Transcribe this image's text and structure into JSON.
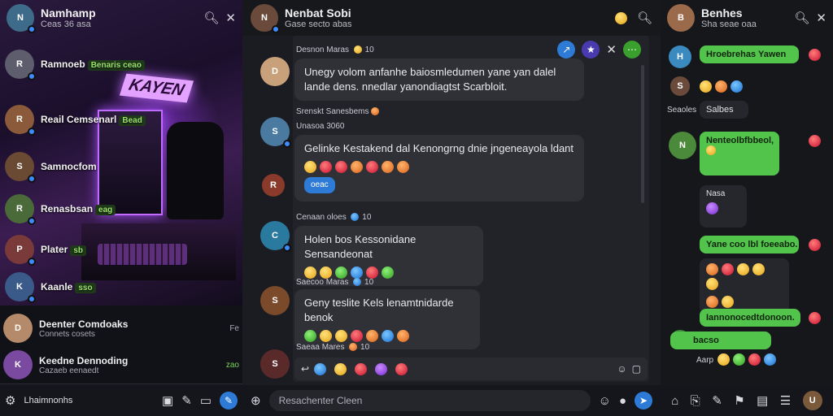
{
  "left": {
    "header": {
      "title": "Namhamp",
      "subtitle": "Ceas 36 asa"
    },
    "hero_sign": "KAYEN",
    "chats": [
      {
        "name": "Ramnoeb",
        "tag": "Benaris ceao"
      },
      {
        "name": "Reail Cemsenarl",
        "tag": "Bead"
      },
      {
        "name": "Samnocfom",
        "tag": ""
      },
      {
        "name": "Renasbsan",
        "tag": "eag"
      },
      {
        "name": "Plater",
        "tag": "sb"
      },
      {
        "name": "Kaanle",
        "tag": "sso"
      }
    ],
    "list": [
      {
        "name": "Deenter Comdoaks",
        "sub": "Connets cosets",
        "meta": "Fe"
      },
      {
        "name": "Keedne Dennoding",
        "sub": "Cazaeb eenaedt",
        "meta": "zao"
      }
    ],
    "bottom_label": "Lhaimnonhs"
  },
  "mid": {
    "header": {
      "title": "Nenbat Sobi",
      "subtitle": "Gase secto abas"
    },
    "messages": [
      {
        "name": "Desnon Maras",
        "meta": "10",
        "text": "Unegy volom anfanhe baiosmledumen yane yan dalel lande dens. nnedlar yanondiagtst Scarbloit."
      },
      {
        "name": "Srenskt Sanesbems",
        "meta": "Unasoa 3060",
        "text": "Gelinke Kestakend dal Kenongrng dnie jngeneayola ldant",
        "chip": "oeac"
      },
      {
        "name": "Cenaan oloes",
        "meta": "10",
        "text": "Holen bos Kessonidane Sensandeonat"
      },
      {
        "name": "Saecoo Maras",
        "meta": "10",
        "text": "Geny teslite Kels lenamtnidarde benok"
      },
      {
        "name": "Saeaa Mares",
        "meta": "10",
        "text": ""
      }
    ],
    "compose_placeholder": "Resachenter Cleen"
  },
  "right": {
    "header": {
      "title": "Benhes",
      "subtitle": "Sha seae oaa"
    },
    "bubbles": [
      "Hroebrehas Yawen",
      "Salbes",
      "Nenteolbfbbeol,",
      "Nasa",
      "Yane coo lbl foeeabo.",
      "Iannonocedtdonoon.",
      "bacso"
    ],
    "sub_label": "Seaoles",
    "meta_label": "Aarp"
  }
}
